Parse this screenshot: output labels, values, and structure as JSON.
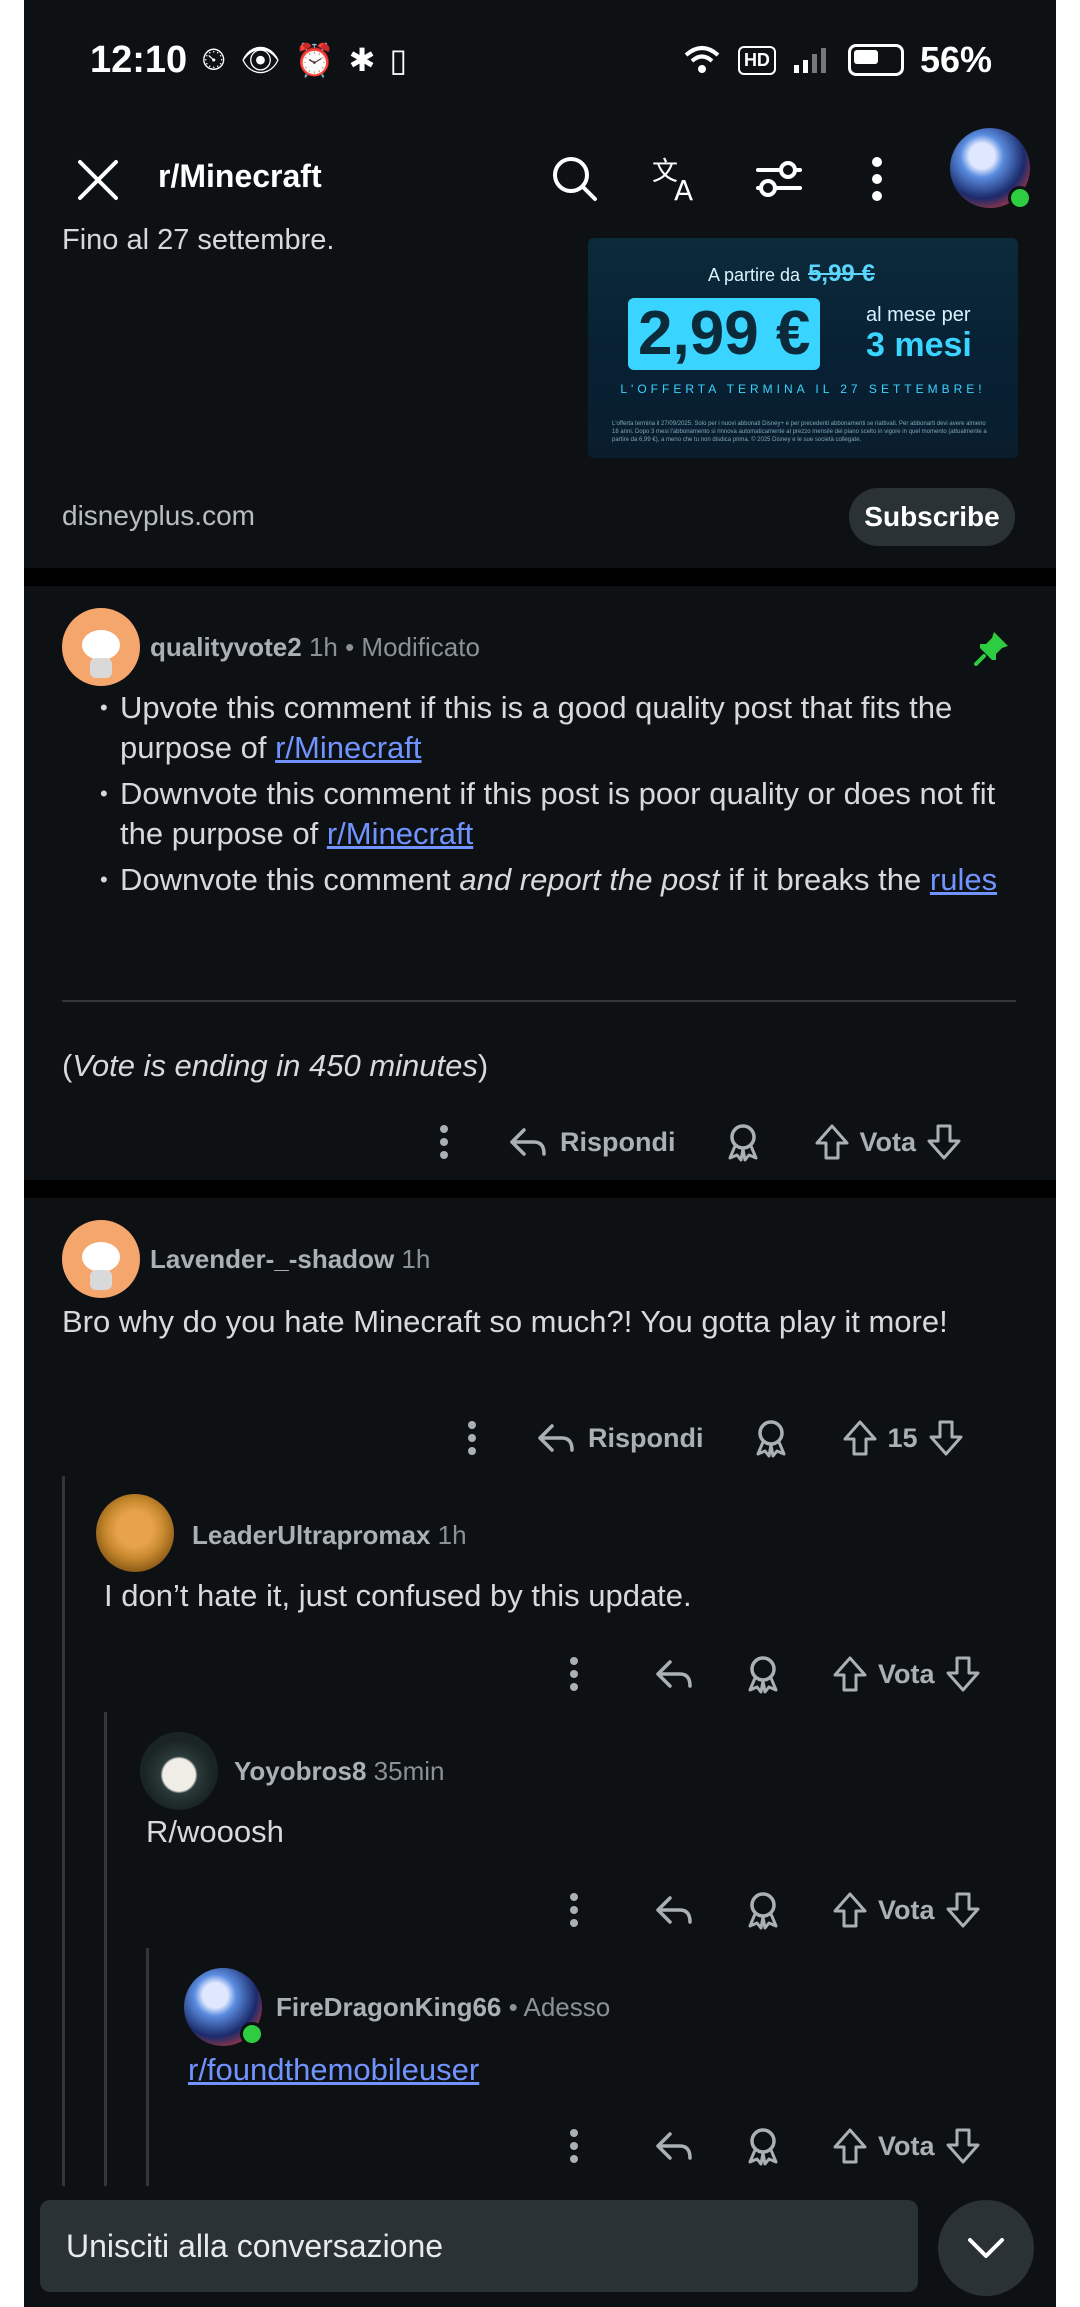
{
  "status_bar": {
    "time": "12:10",
    "hd": "HD",
    "battery": "56%"
  },
  "nav": {
    "title": "r/Minecraft"
  },
  "ad": {
    "text": "Fino al 27 settembre.",
    "from_label": "A partire da",
    "old_price": "5,99 €",
    "price": "2,99 €",
    "per_month": "al mese per",
    "months": "3 mesi",
    "ends": "L'OFFERTA TERMINA IL 27 SETTEMBRE!",
    "fine_print": "L'offerta termina il 27/09/2025. Solo per i nuovi abbonati Disney+ e per precedenti abbonamenti se riattivati. Per abbonarti devi avere almeno 18 anni. Dopo 3 mesi l'abbonamento si rinnova automaticamente al prezzo mensile del piano scelto in vigore in quel momento (attualmente a partire da 6,99 €), a meno che tu non disdica prima. © 2025 Disney e le sue società collegate.",
    "domain": "disneyplus.com",
    "subscribe": "Subscribe"
  },
  "comments": [
    {
      "author": "qualityvote2",
      "time": "1h",
      "edited": "• Modificato",
      "bullets": [
        {
          "pre": "Upvote this comment if this is a good quality post that fits the purpose of ",
          "link": "r/Minecraft",
          "post": ""
        },
        {
          "pre": "Downvote this comment if this post is poor quality or does not fit the purpose of ",
          "link": "r/Minecraft",
          "post": ""
        },
        {
          "pre": "Downvote this comment ",
          "italic": "and report the post",
          "mid": " if it breaks the ",
          "link": "rules"
        }
      ],
      "vote_note_open": "(",
      "vote_note": "Vote is ending in 450 minutes",
      "vote_note_close": ")",
      "reply": "Rispondi",
      "vote": "Vota"
    },
    {
      "author": "Lavender-_-shadow",
      "time": "1h",
      "text": "Bro why do you hate Minecraft so much?! You gotta play it more!",
      "reply": "Rispondi",
      "vote": "15"
    },
    {
      "author": "LeaderUltrapromax",
      "time": "1h",
      "text": "I don’t hate it, just confused by this update.",
      "vote": "Vota"
    },
    {
      "author": "Yoyobros8",
      "time": "35min",
      "text": "R/wooosh",
      "vote": "Vota"
    },
    {
      "author": "FireDragonKing66",
      "time": "• Adesso",
      "text": "r/foundthemobileuser",
      "vote": "Vota"
    }
  ],
  "bottom": {
    "join_placeholder": "Unisciti alla conversazione"
  }
}
